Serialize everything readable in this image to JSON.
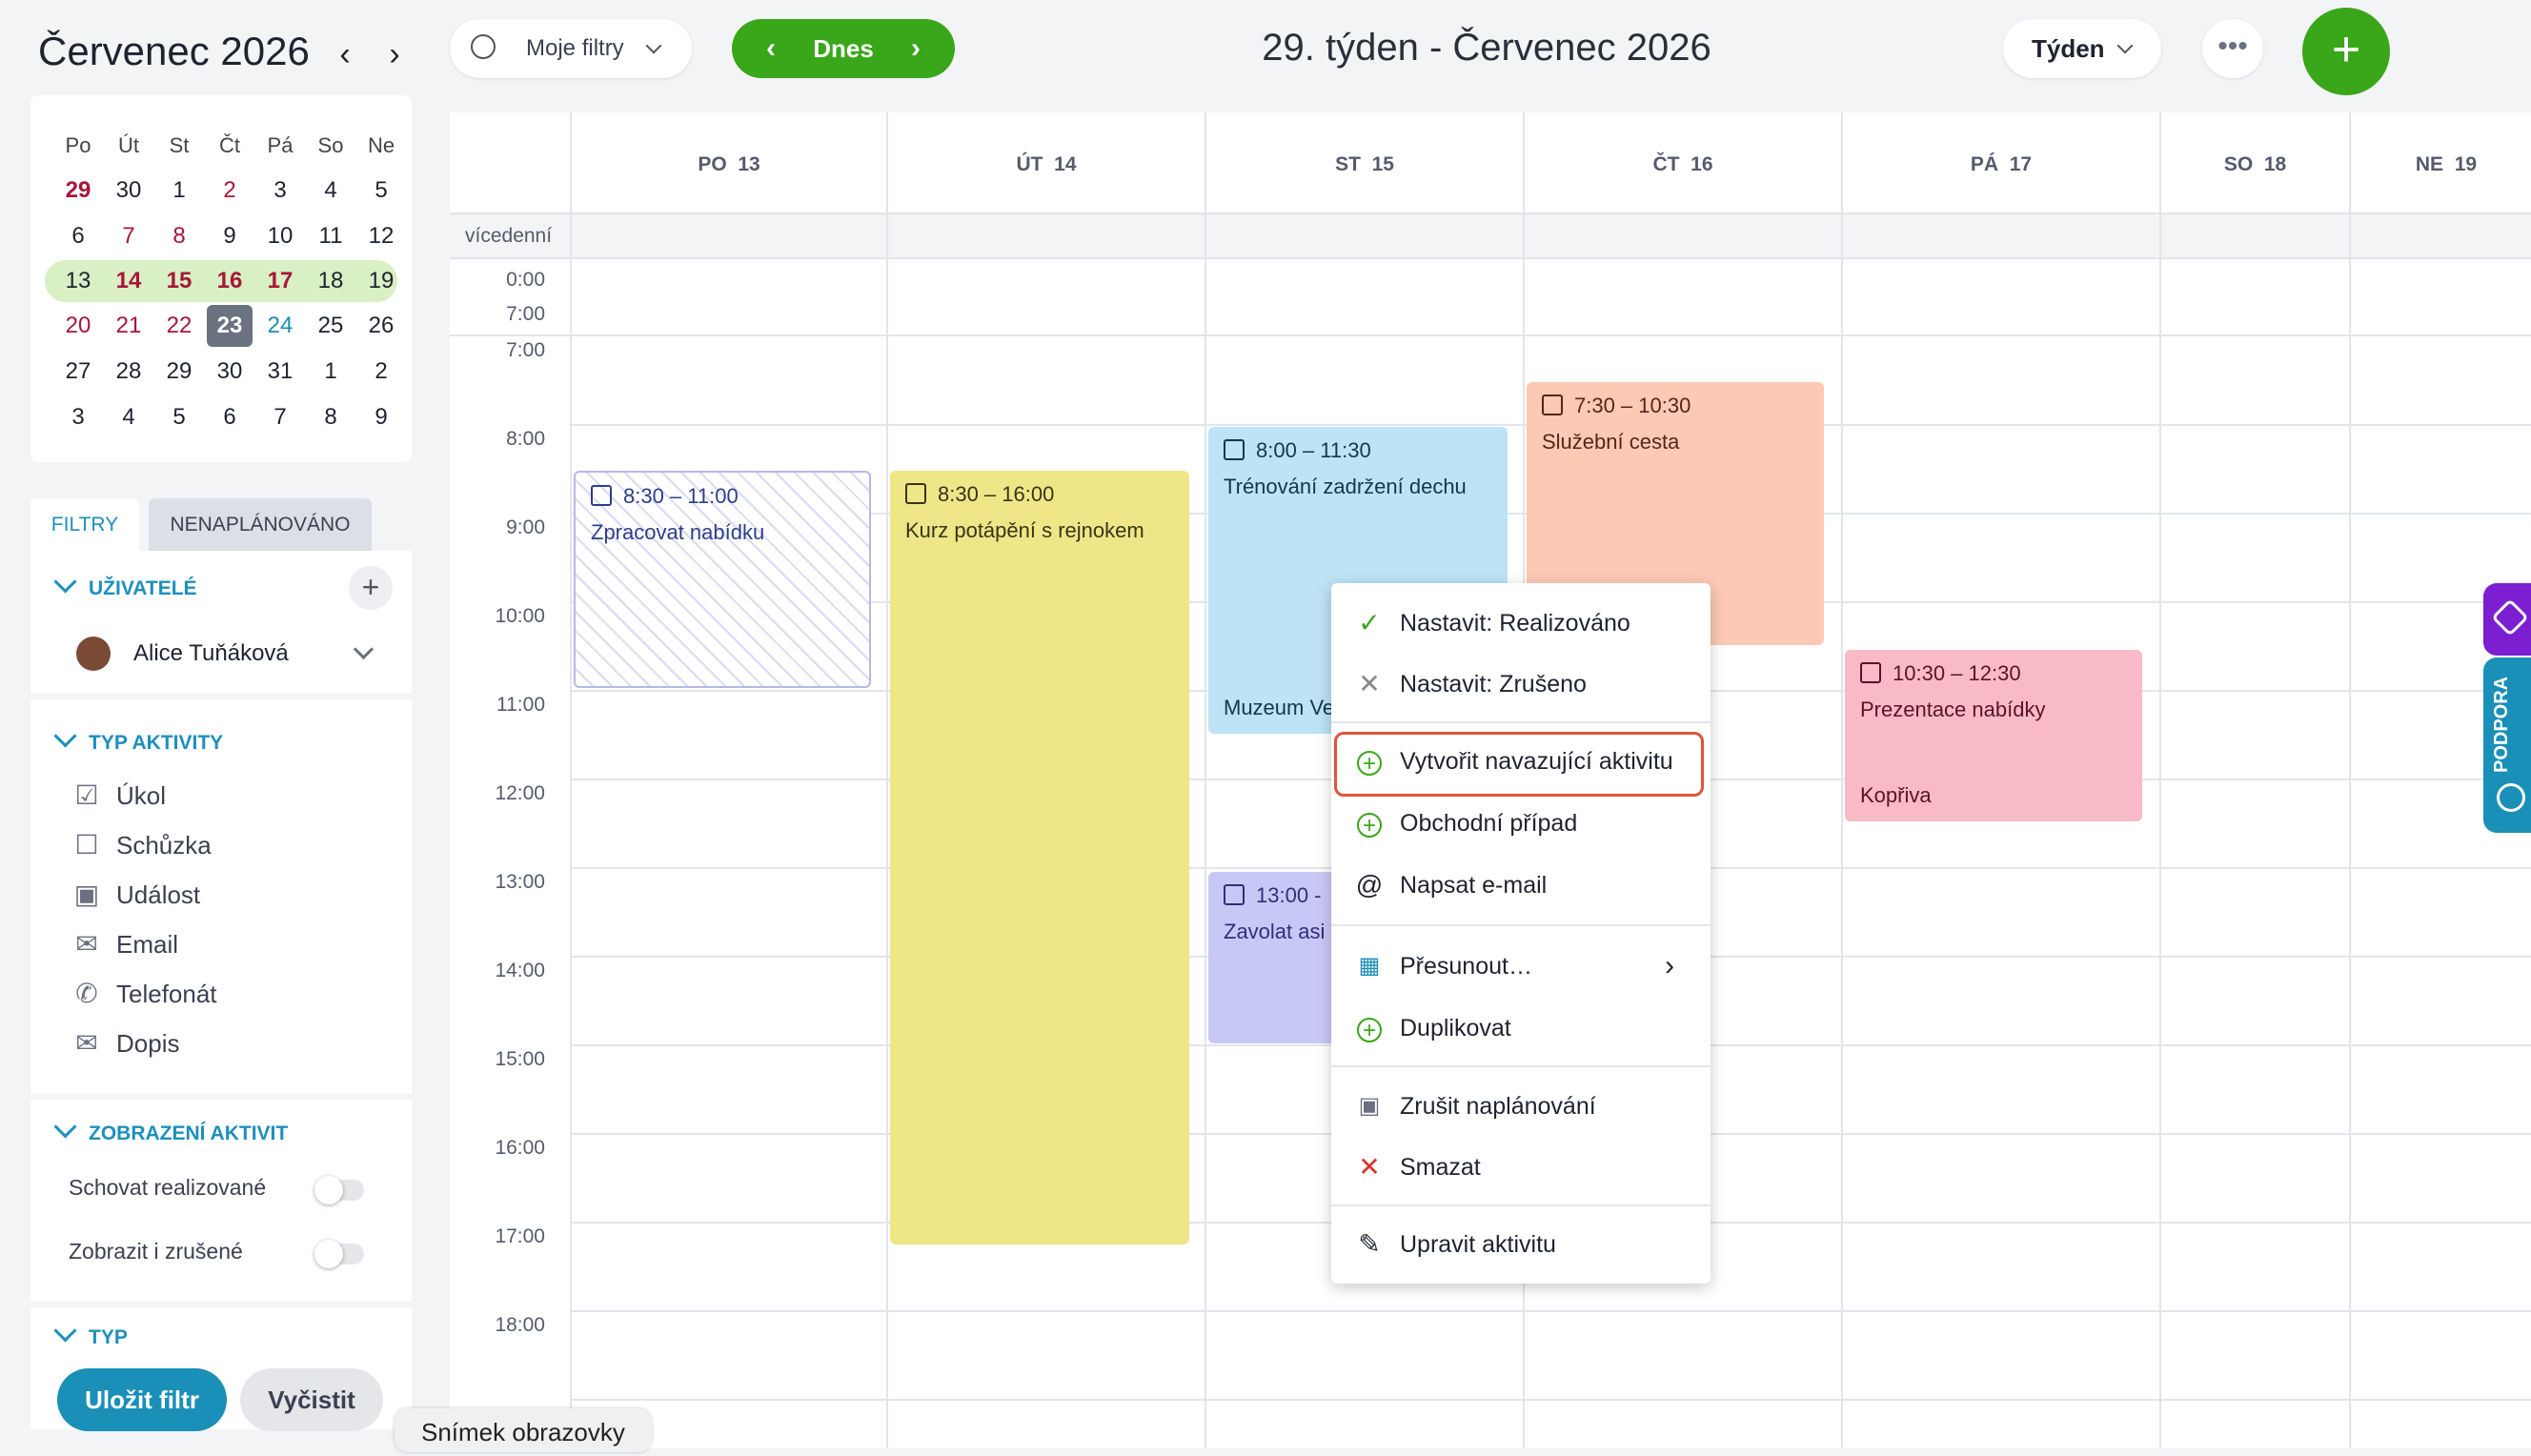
{
  "sidebar": {
    "month_title": "Červenec  2026",
    "prev_arrow": "‹",
    "next_arrow": "›",
    "mini_cal": {
      "weekdays": [
        "Po",
        "Út",
        "St",
        "Čt",
        "Pá",
        "So",
        "Ne"
      ],
      "weeks": [
        [
          "29",
          "30",
          "1",
          "2",
          "3",
          "4",
          "5"
        ],
        [
          "6",
          "7",
          "8",
          "9",
          "10",
          "11",
          "12"
        ],
        [
          "13",
          "14",
          "15",
          "16",
          "17",
          "18",
          "19"
        ],
        [
          "20",
          "21",
          "22",
          "23",
          "24",
          "25",
          "26"
        ],
        [
          "27",
          "28",
          "29",
          "30",
          "31",
          "1",
          "2"
        ],
        [
          "3",
          "4",
          "5",
          "6",
          "7",
          "8",
          "9"
        ]
      ],
      "today": "23"
    },
    "tabs": {
      "filters": "FILTRY",
      "unplanned": "NENAPLÁNOVÁNO"
    },
    "users": {
      "heading": "UŽIVATELÉ",
      "add": "+",
      "user_name": "Alice Tuňáková"
    },
    "activity_type": {
      "heading": "TYP AKTIVITY",
      "items": [
        {
          "label": "Úkol",
          "icon": "task-icon"
        },
        {
          "label": "Schůzka",
          "icon": "meeting-icon"
        },
        {
          "label": "Událost",
          "icon": "event-icon"
        },
        {
          "label": "Email",
          "icon": "email-icon"
        },
        {
          "label": "Telefonát",
          "icon": "phone-icon"
        },
        {
          "label": "Dopis",
          "icon": "letter-icon"
        }
      ]
    },
    "display": {
      "heading": "ZOBRAZENÍ AKTIVIT",
      "hide_done": "Schovat realizované",
      "show_cancelled": "Zobrazit i zrušené"
    },
    "type_heading": "TYP",
    "save_filter": "Uložit filtr",
    "clear_filter": "Vyčistit"
  },
  "toolbar": {
    "my_filters": "Moje filtry",
    "today": "Dnes",
    "week_title": "29. týden - Červenec 2026",
    "view": "Týden",
    "more": "•••",
    "add": "+"
  },
  "calendar": {
    "days": [
      {
        "name": "PO",
        "num": "13"
      },
      {
        "name": "ÚT",
        "num": "14"
      },
      {
        "name": "ST",
        "num": "15"
      },
      {
        "name": "ČT",
        "num": "16"
      },
      {
        "name": "PÁ",
        "num": "17"
      },
      {
        "name": "SO",
        "num": "18"
      },
      {
        "name": "NE",
        "num": "19"
      }
    ],
    "multiday_label": "vícedenní",
    "collapsed_range": [
      "0:00",
      "7:00"
    ],
    "hours": [
      "7:00",
      "8:00",
      "9:00",
      "10:00",
      "11:00",
      "12:00",
      "13:00",
      "14:00",
      "15:00",
      "16:00",
      "17:00",
      "18:00"
    ],
    "events": [
      {
        "time": "8:30 – 11:00",
        "title": "Zpracovat nabídku",
        "location": "",
        "color": "#e8e8f8"
      },
      {
        "time": "8:30 – 16:00",
        "title": "Kurz potápění s rejnokem",
        "location": "",
        "color": "#efe687"
      },
      {
        "time": "8:00 – 11:30",
        "title": "Trénování zadržení dechu",
        "location": "Muzeum Ve",
        "color": "#bde3f5"
      },
      {
        "time": "7:30 – 10:30",
        "title": "Služební cesta",
        "location": "",
        "color": "#fcc9b5"
      },
      {
        "time": "10:30 – 12:30",
        "title": "Prezentace nabídky",
        "location": "Kopřiva",
        "color": "#f8bac6"
      },
      {
        "time": "13:00 -",
        "title": "Zavolat asi",
        "location": "",
        "color": "#c8c8f6"
      }
    ]
  },
  "context_menu": {
    "items": [
      {
        "label": "Nastavit: Realizováno",
        "icon": "check-icon"
      },
      {
        "label": "Nastavit: Zrušeno",
        "icon": "x-icon"
      },
      {
        "label": "Vytvořit navazující aktivitu",
        "icon": "plus-circle-icon"
      },
      {
        "label": "Obchodní případ",
        "icon": "plus-circle-icon"
      },
      {
        "label": "Napsat e-mail",
        "icon": "at-icon"
      },
      {
        "label": "Přesunout…",
        "icon": "calendar-move-icon"
      },
      {
        "label": "Duplikovat",
        "icon": "duplicate-icon"
      },
      {
        "label": "Zrušit naplánování",
        "icon": "calendar-x-icon"
      },
      {
        "label": "Smazat",
        "icon": "delete-x-icon"
      },
      {
        "label": "Upravit aktivitu",
        "icon": "pencil-icon"
      }
    ],
    "submenu_arrow": "›"
  },
  "side_tabs": {
    "support": "PODPORA"
  },
  "tooltip": "Snímek obrazovky"
}
